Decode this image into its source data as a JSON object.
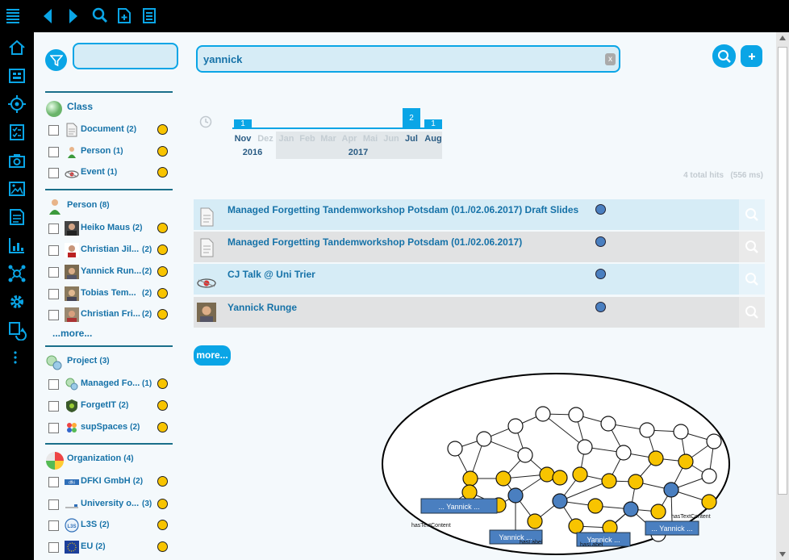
{
  "search": {
    "query": "yannick",
    "clear_label": "x",
    "facet_filter_value": ""
  },
  "timeline": {
    "months": [
      {
        "label": "Nov",
        "active": true,
        "count": "1"
      },
      {
        "label": "Dez",
        "active": false,
        "count": ""
      },
      {
        "label": "Jan",
        "active": false,
        "count": ""
      },
      {
        "label": "Feb",
        "active": false,
        "count": ""
      },
      {
        "label": "Mar",
        "active": false,
        "count": ""
      },
      {
        "label": "Apr",
        "active": false,
        "count": ""
      },
      {
        "label": "Mai",
        "active": false,
        "count": ""
      },
      {
        "label": "Jun",
        "active": false,
        "count": ""
      },
      {
        "label": "Jul",
        "active": true,
        "count": "2"
      },
      {
        "label": "Aug",
        "active": true,
        "count": "1"
      }
    ],
    "years": [
      "2016",
      "2017"
    ]
  },
  "hits": {
    "total": "4 total hits",
    "time": "(556 ms)"
  },
  "facets": {
    "class": {
      "title": "Class",
      "items": [
        {
          "label": "Document",
          "count": "(2)",
          "icon": "document-icon"
        },
        {
          "label": "Person",
          "count": "(1)",
          "icon": "person-icon"
        },
        {
          "label": "Event",
          "count": "(1)",
          "icon": "event-icon"
        }
      ]
    },
    "person": {
      "title": "Person",
      "count": "(8)",
      "items": [
        {
          "label": "Heiko Maus",
          "count": "(2)"
        },
        {
          "label": "Christian Jil...",
          "count": "(2)"
        },
        {
          "label": "Yannick Run...",
          "count": "(2)"
        },
        {
          "label": "Tobias Tem...",
          "count": "(2)"
        },
        {
          "label": "Christian Fri...",
          "count": "(2)"
        }
      ],
      "more": "...more..."
    },
    "project": {
      "title": "Project",
      "count": "(3)",
      "items": [
        {
          "label": "Managed Fo...",
          "count": "(1)"
        },
        {
          "label": "ForgetIT",
          "count": "(2)"
        },
        {
          "label": "supSpaces",
          "count": "(2)"
        }
      ]
    },
    "organization": {
      "title": "Organization",
      "count": "(4)",
      "items": [
        {
          "label": "DFKI GmbH",
          "count": "(2)"
        },
        {
          "label": "University o...",
          "count": "(3)"
        },
        {
          "label": "L3S",
          "count": "(2)"
        },
        {
          "label": "EU",
          "count": "(2)"
        }
      ]
    }
  },
  "results": [
    {
      "title": "Managed Forgetting Tandemworkshop Potsdam (01./02.06.2017) Draft Slides",
      "icon": "document-icon"
    },
    {
      "title": "Managed Forgetting Tandemworkshop Potsdam (01./02.06.2017)",
      "icon": "document-icon"
    },
    {
      "title": "CJ Talk @ Uni Trier",
      "icon": "event-icon"
    },
    {
      "title": "Yannick Runge",
      "icon": "person-photo"
    }
  ],
  "more_button": "more...",
  "graph": {
    "labels": [
      "... Yannick ...",
      "Yannick ...",
      "Yannick ...",
      "... Yannick ..."
    ],
    "edge_labels": [
      "hasTextContent",
      "hasLabel",
      "hasLabel",
      "hasTextContent"
    ]
  },
  "colors": {
    "accent": "#0aa5e6",
    "yellow": "#f8c400",
    "blue_node": "#4a7fc0"
  }
}
